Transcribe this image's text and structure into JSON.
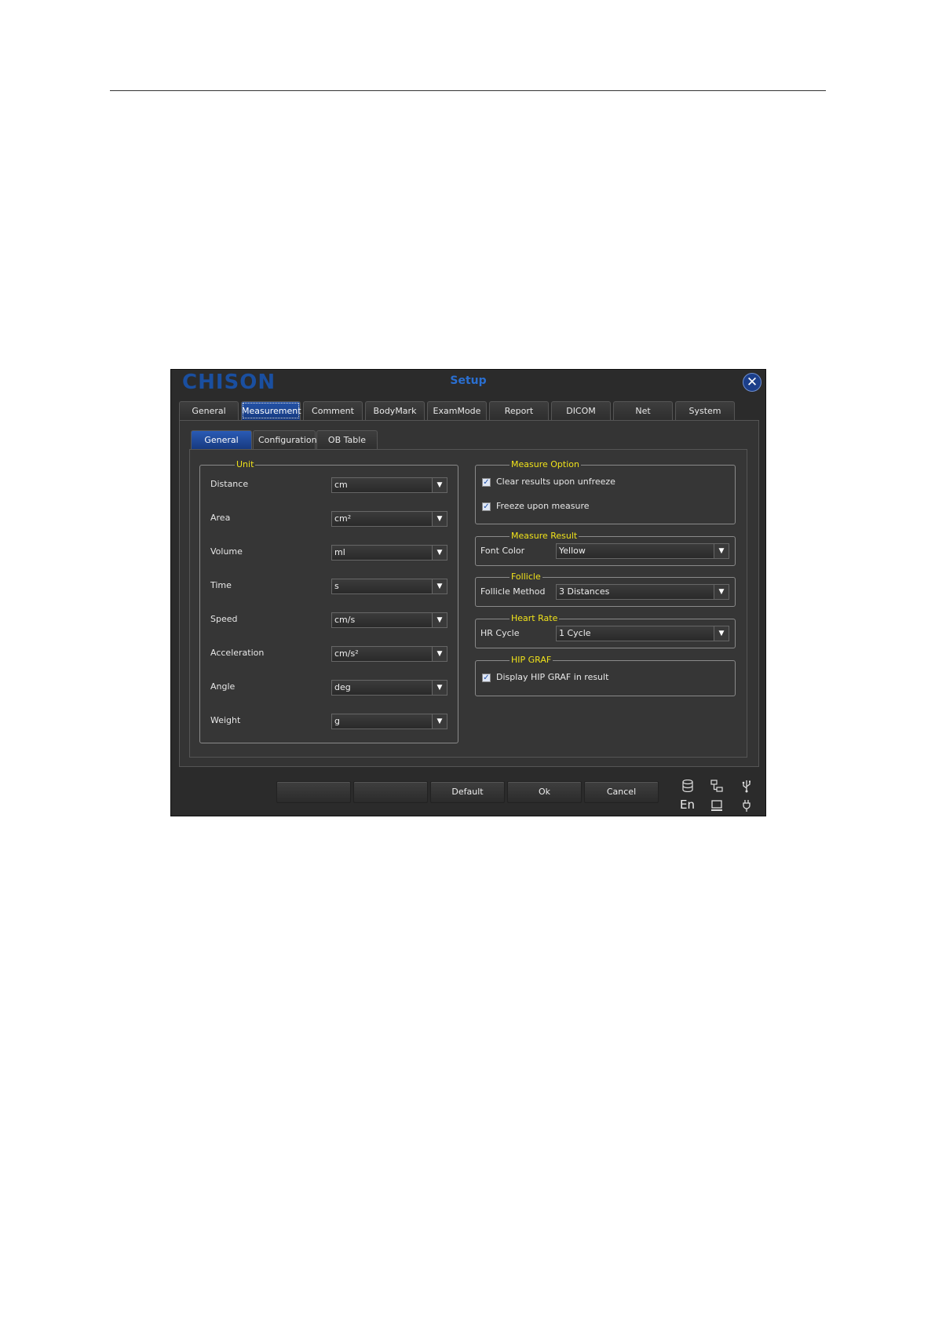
{
  "window": {
    "logo": "CHISON",
    "title": "Setup",
    "close_icon": "close-icon"
  },
  "tabs": [
    {
      "label": "General",
      "active": false
    },
    {
      "label": "Measurement",
      "active": true
    },
    {
      "label": "Comment",
      "active": false
    },
    {
      "label": "BodyMark",
      "active": false
    },
    {
      "label": "ExamMode",
      "active": false
    },
    {
      "label": "Report",
      "active": false
    },
    {
      "label": "DICOM",
      "active": false
    },
    {
      "label": "Net",
      "active": false
    },
    {
      "label": "System",
      "active": false
    }
  ],
  "subtabs": [
    {
      "label": "General",
      "active": true
    },
    {
      "label": "Configuration",
      "active": false
    },
    {
      "label": "OB Table",
      "active": false
    }
  ],
  "unit": {
    "legend": "Unit",
    "rows": [
      {
        "label": "Distance",
        "value": "cm"
      },
      {
        "label": "Area",
        "value": "cm²"
      },
      {
        "label": "Volume",
        "value": "ml"
      },
      {
        "label": "Time",
        "value": "s"
      },
      {
        "label": "Speed",
        "value": "cm/s"
      },
      {
        "label": "Acceleration",
        "value": "cm/s²"
      },
      {
        "label": "Angle",
        "value": "deg"
      },
      {
        "label": "Weight",
        "value": "g"
      }
    ]
  },
  "measure_option": {
    "legend": "Measure Option",
    "clear_results": {
      "label": "Clear results upon unfreeze",
      "checked": true
    },
    "freeze_upon_measure": {
      "label": "Freeze upon measure",
      "checked": true
    }
  },
  "measure_result": {
    "legend": "Measure Result",
    "font_color_label": "Font Color",
    "font_color_value": "Yellow"
  },
  "follicle": {
    "legend": "Follicle",
    "method_label": "Follicle Method",
    "method_value": "3 Distances"
  },
  "heart_rate": {
    "legend": "Heart Rate",
    "hr_cycle_label": "HR Cycle",
    "hr_cycle_value": "1 Cycle"
  },
  "hip_graf": {
    "legend": "HIP GRAF",
    "display_label": "Display HIP GRAF in result",
    "checked": true
  },
  "bottom": {
    "blank1": "",
    "blank2": "",
    "default_label": "Default",
    "ok_label": "Ok",
    "cancel_label": "Cancel",
    "language": "En"
  },
  "colors": {
    "legend": "#f0e21a",
    "accent": "#1f4fa8",
    "background": "#2b2b2b"
  }
}
